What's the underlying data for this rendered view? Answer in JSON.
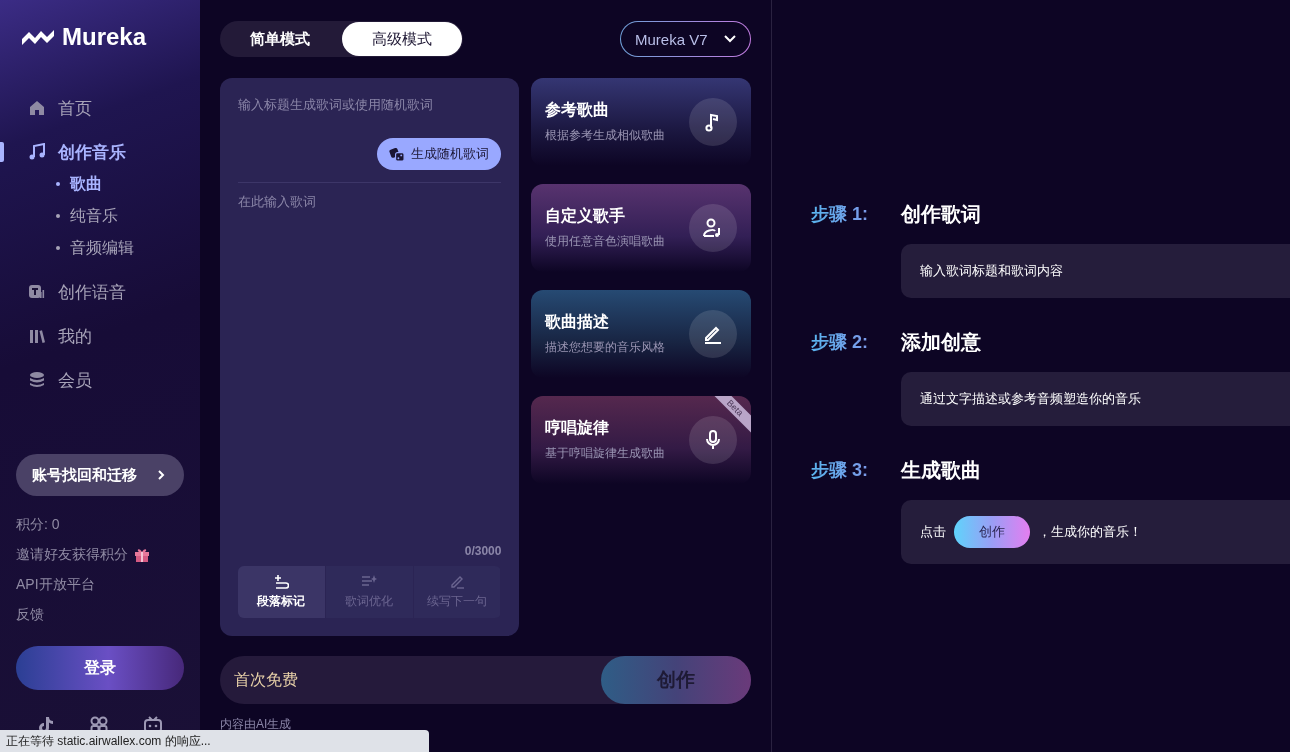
{
  "logo": {
    "text": "Mureka"
  },
  "nav": [
    {
      "label": "首页",
      "selected": false
    },
    {
      "label": "创作音乐",
      "selected": true,
      "children": [
        {
          "label": "歌曲",
          "selected": true
        },
        {
          "label": "纯音乐",
          "selected": false
        },
        {
          "label": "音频编辑",
          "selected": false
        }
      ]
    },
    {
      "label": "创作语音",
      "selected": false
    },
    {
      "label": "我的",
      "selected": false
    },
    {
      "label": "会员",
      "selected": false
    }
  ],
  "account_button": {
    "label": "账号找回和迁移"
  },
  "links": [
    {
      "label": "积分: 0",
      "kind": "text"
    },
    {
      "label": "邀请好友获得积分",
      "kind": "reward"
    },
    {
      "label": "API开放平台",
      "kind": "text"
    },
    {
      "label": "反馈",
      "kind": "text"
    }
  ],
  "login_button": {
    "label": "登录"
  },
  "mode_tabs": [
    {
      "label": "简单模式",
      "selected": false
    },
    {
      "label": "高级模式",
      "selected": true
    }
  ],
  "model_select": {
    "value": "Mureka V7"
  },
  "lyrics": {
    "title_placeholder": "输入标题生成歌词或使用随机歌词",
    "random_button": "生成随机歌词",
    "placeholder": "在此输入歌词",
    "counter": "0/3000",
    "tools": [
      {
        "label": "段落标记",
        "disabled": false
      },
      {
        "label": "歌词优化",
        "disabled": true
      },
      {
        "label": "续写下一句",
        "disabled": true
      }
    ]
  },
  "cards": [
    {
      "title": "参考歌曲",
      "subtitle": "根据参考生成相似歌曲"
    },
    {
      "title": "自定义歌手",
      "subtitle": "使用任意音色演唱歌曲"
    },
    {
      "title": "歌曲描述",
      "subtitle": "描述您想要的音乐风格"
    },
    {
      "title": "哼唱旋律",
      "subtitle": "基于哼唱旋律生成歌曲",
      "badge": "Beta"
    }
  ],
  "create_bar": {
    "placeholder": "首次免费",
    "button": "创作",
    "disabled": true
  },
  "footnote": "内容由AI生成",
  "steps": [
    {
      "label": "步骤 1:",
      "title": "创作歌词",
      "kind": "text",
      "text": "输入歌词标题和歌词内容"
    },
    {
      "label": "步骤 2:",
      "title": "添加创意",
      "kind": "text",
      "text": "通过文字描述或参考音频塑造你的音乐"
    },
    {
      "label": "步骤 3:",
      "title": "生成歌曲",
      "kind": "action",
      "text_before": "点击",
      "button": "创作",
      "text_after": "，生成你的音乐！"
    }
  ],
  "status_bar": "正在等待 static.airwallex.com 的响应..."
}
